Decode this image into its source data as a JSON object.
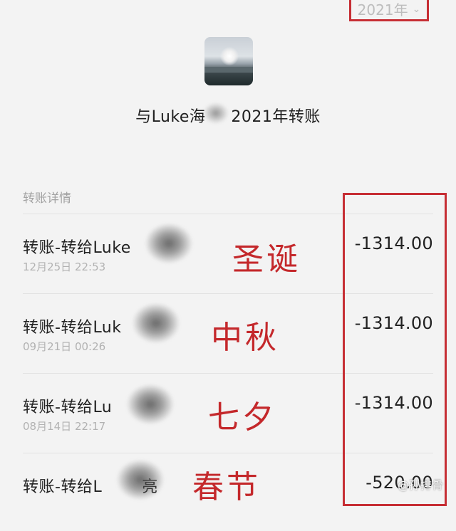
{
  "header": {
    "year_label": "2021年",
    "title": "与Luke海",
    "title_suffix": "2021年转账"
  },
  "section": {
    "label": "转账详情"
  },
  "transfers": [
    {
      "title": "转账-转给Luke",
      "time": "12月25日 22:53",
      "amount": "-1314.00",
      "annotation": "圣诞"
    },
    {
      "title": "转账-转给Luk",
      "time": "09月21日 00:26",
      "amount": "-1314.00",
      "annotation": "中秋"
    },
    {
      "title": "转账-转给Lu",
      "time": "08月14日 22:17",
      "amount": "-1314.00",
      "annotation": "七夕"
    },
    {
      "title": "转账-转给L",
      "title_tail": "亮",
      "time": "",
      "amount": "-520.00",
      "annotation": "春节"
    }
  ],
  "watermark": "@孙排骨",
  "colors": {
    "annotation_red": "#c4282b",
    "box_red": "#c62e34"
  }
}
